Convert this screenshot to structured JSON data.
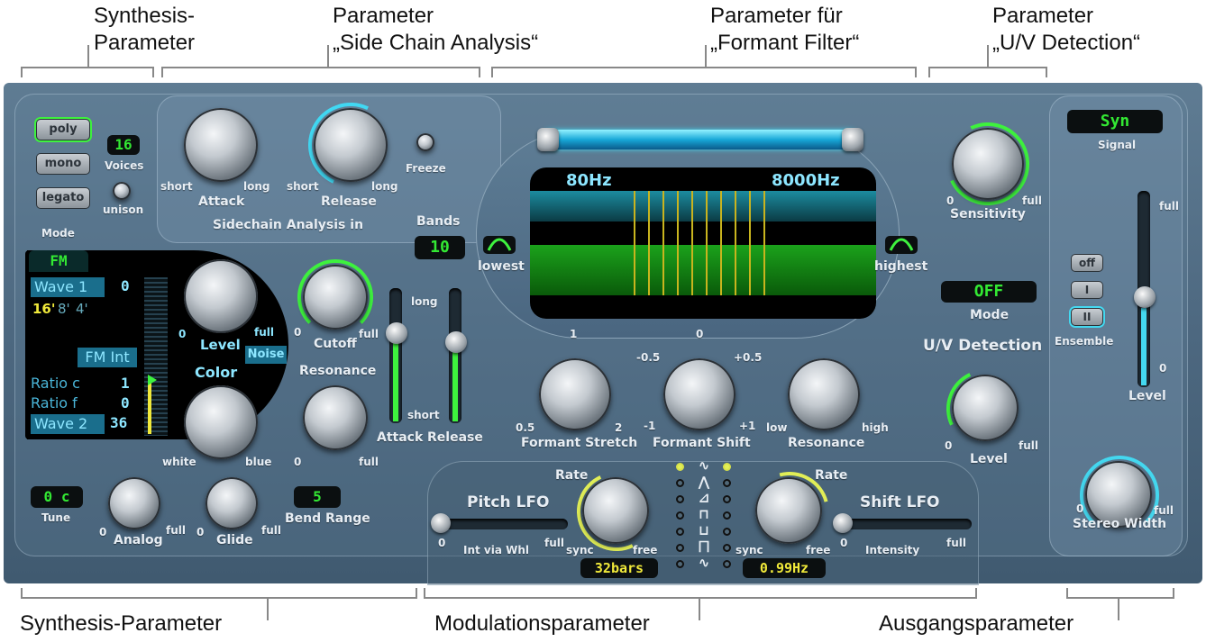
{
  "callouts": {
    "top_synthesis": "Synthesis-\nParameter",
    "top_sidechain": "Parameter\n„Side Chain Analysis“",
    "top_formant": "Parameter für\n„Formant Filter“",
    "top_uv": "Parameter\n„U/V Detection“",
    "bottom_synthesis": "Synthesis-Parameter",
    "bottom_modulation": "Modulationsparameter",
    "bottom_output": "Ausgangsparameter"
  },
  "mode": {
    "poly": "poly",
    "mono": "mono",
    "legato": "legato",
    "voices_value": "16",
    "voices_label": "Voices",
    "unison_label": "unison",
    "mode_label": "Mode"
  },
  "sidechain": {
    "attack_min": "short",
    "attack_max": "long",
    "attack_label": "Attack",
    "release_min": "short",
    "release_max": "long",
    "release_label": "Release",
    "freeze_label": "Freeze",
    "section_label": "Sidechain Analysis in",
    "bands_label": "Bands",
    "bands_value": "10"
  },
  "synth_display": {
    "tab": "FM",
    "wave1": "Wave 1",
    "wave1_value": "0",
    "feet": [
      "16'",
      "8'",
      "4'"
    ],
    "fm_int": "FM Int",
    "ratio_c": "Ratio c",
    "ratio_c_value": "1",
    "ratio_f": "Ratio f",
    "ratio_f_value": "0",
    "wave2": "Wave 2",
    "wave2_value": "36"
  },
  "synth_knobs": {
    "level_min": "0",
    "level_max": "full",
    "level_label": "Level",
    "noise_label": "Noise",
    "color_label": "Color",
    "color_min": "white",
    "color_max": "blue",
    "cutoff_min": "0",
    "cutoff_max": "full",
    "cutoff_label": "Cutoff",
    "resonance_label": "Resonance",
    "resonance_min": "0",
    "resonance_max": "full",
    "env_long": "long",
    "env_short": "short",
    "env_attack": "Attack",
    "env_release": "Release"
  },
  "tune": {
    "tune_value": "0 c",
    "tune_label": "Tune",
    "analog_min": "0",
    "analog_max": "full",
    "analog_label": "Analog",
    "glide_min": "0",
    "glide_max": "full",
    "glide_label": "Glide",
    "bend_value": "5",
    "bend_label": "Bend Range"
  },
  "formant": {
    "low_freq": "80Hz",
    "high_freq": "8000Hz",
    "lowest_label": "lowest",
    "highest_label": "highest",
    "stretch_top": "1",
    "stretch_min": "0.5",
    "stretch_max": "2",
    "stretch_label": "Formant Stretch",
    "shift_top": "0",
    "shift_left": "-0.5",
    "shift_right": "+0.5",
    "shift_min": "-1",
    "shift_max": "+1",
    "shift_label": "Formant Shift",
    "res_min": "low",
    "res_max": "high",
    "res_label": "Resonance",
    "band_count": 10
  },
  "uv": {
    "sensitivity_min": "0",
    "sensitivity_max": "full",
    "sensitivity_label": "Sensitivity",
    "mode_value": "OFF",
    "mode_label": "Mode",
    "section_label": "U/V Detection",
    "level_min": "0",
    "level_max": "full",
    "level_label": "Level"
  },
  "output": {
    "signal_value": "Syn",
    "signal_label": "Signal",
    "ens_off": "off",
    "ens_i": "I",
    "ens_ii": "II",
    "ensemble_label": "Ensemble",
    "level_max": "full",
    "level_min": "0",
    "level_label": "Level",
    "stereo_min": "0",
    "stereo_max": "full",
    "stereo_label": "Stereo Width"
  },
  "lfo": {
    "pitch_title": "Pitch LFO",
    "pitch_rate_label": "Rate",
    "pitch_sync": "sync",
    "pitch_free": "free",
    "pitch_rate_value": "32bars",
    "int_label": "Int via Whl",
    "int_min": "0",
    "int_max": "full",
    "shift_title": "Shift LFO",
    "shift_rate_label": "Rate",
    "shift_sync": "sync",
    "shift_free": "free",
    "shift_rate_value": "0.99Hz",
    "intensity_label": "Intensity",
    "intensity_min": "0",
    "intensity_max": "full"
  },
  "colors": {
    "panel": "#4d6880",
    "lcd_green": "#33e833",
    "lcd_yellow": "#f0e93a",
    "accent_cyan": "#44d8f0"
  }
}
